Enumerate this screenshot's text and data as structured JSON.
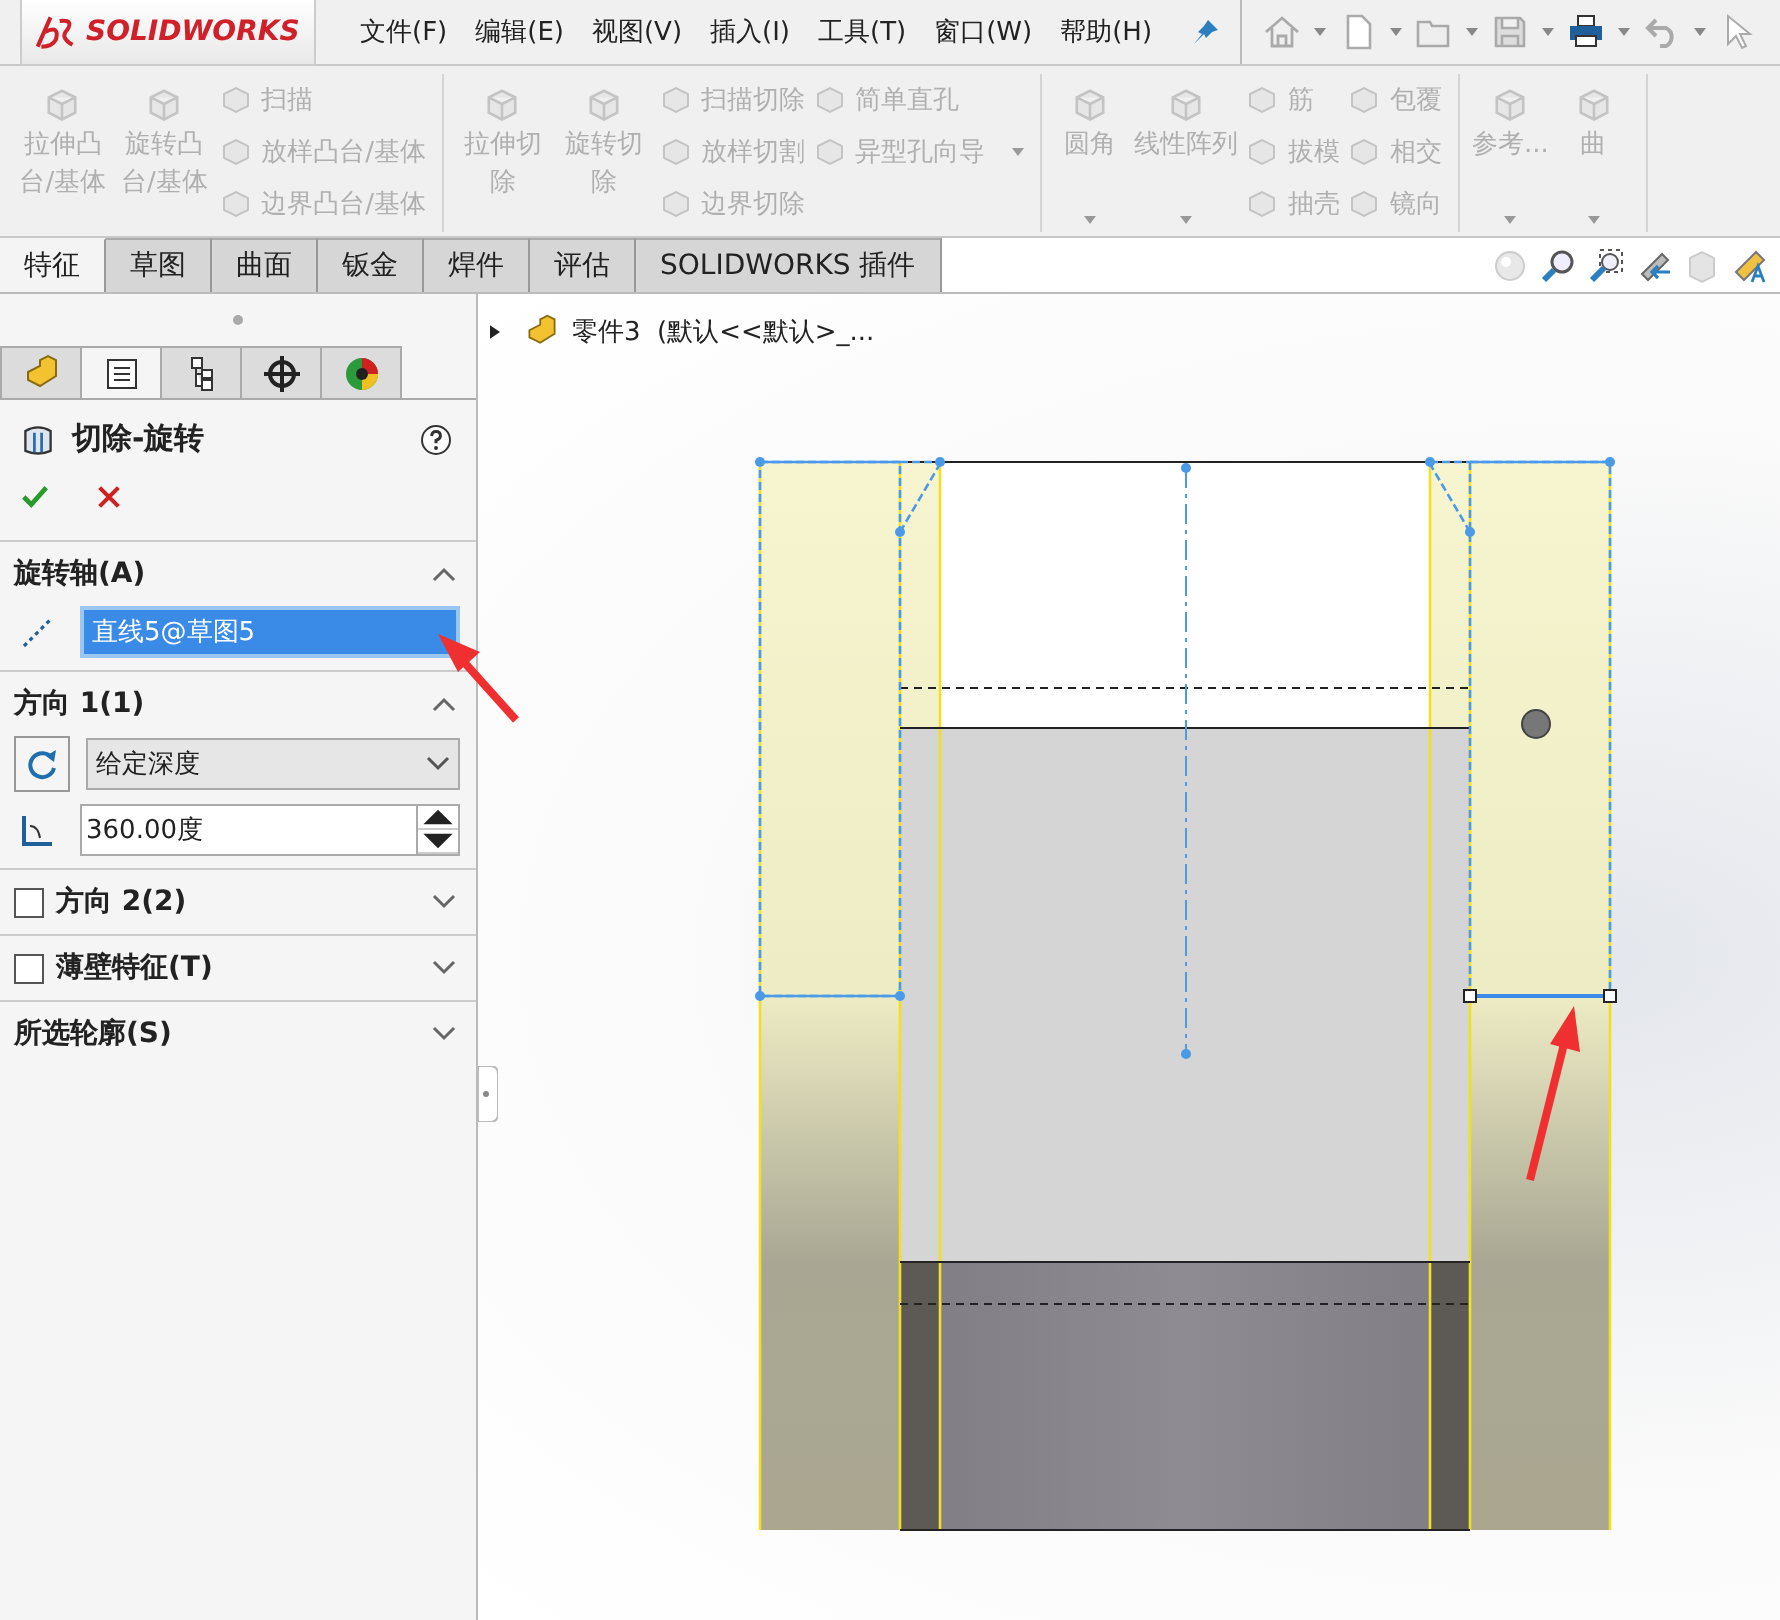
{
  "app": {
    "logo": "SOLIDWORKS"
  },
  "menu": [
    {
      "label": "文件(F)"
    },
    {
      "label": "编辑(E)"
    },
    {
      "label": "视图(V)"
    },
    {
      "label": "插入(I)"
    },
    {
      "label": "工具(T)"
    },
    {
      "label": "窗口(W)"
    },
    {
      "label": "帮助(H)"
    }
  ],
  "ribbon": [
    {
      "items": [
        {
          "kind": "large",
          "label": "拉伸凸台/基体"
        },
        {
          "kind": "large",
          "label": "旋转凸台/基体"
        },
        {
          "kind": "column",
          "dropdown": false,
          "entries": [
            "扫描",
            "放样凸台/基体",
            "边界凸台/基体"
          ]
        }
      ]
    },
    {
      "items": [
        {
          "kind": "large",
          "label": "拉伸切除"
        },
        {
          "kind": "large",
          "label": "旋转切除"
        },
        {
          "kind": "column",
          "dropdown": false,
          "entries": [
            "扫描切除",
            "放样切割",
            "边界切除"
          ]
        },
        {
          "kind": "column",
          "dropdown": true,
          "entries": [
            "简单直孔",
            "异型孔向导"
          ]
        }
      ]
    },
    {
      "items": [
        {
          "kind": "large-dropdown",
          "label": "圆角"
        },
        {
          "kind": "large-dropdown",
          "label": "线性阵列"
        },
        {
          "kind": "column",
          "dropdown": false,
          "entries": [
            "筋",
            "拔模",
            "抽壳"
          ]
        },
        {
          "kind": "column",
          "dropdown": false,
          "entries": [
            "包覆",
            "相交",
            "镜向"
          ]
        }
      ]
    },
    {
      "items": [
        {
          "kind": "large-dropdown",
          "label": "参考..."
        },
        {
          "kind": "large-dropdown",
          "label": "曲"
        }
      ]
    }
  ],
  "tabs": [
    {
      "label": "特征",
      "selected": true
    },
    {
      "label": "草图",
      "selected": false
    },
    {
      "label": "曲面",
      "selected": false
    },
    {
      "label": "钣金",
      "selected": false
    },
    {
      "label": "焊件",
      "selected": false
    },
    {
      "label": "评估",
      "selected": false
    },
    {
      "label": "SOLIDWORKS 插件",
      "selected": false
    }
  ],
  "panel_tabs": [
    {
      "selected": false
    },
    {
      "selected": true
    },
    {
      "selected": false
    },
    {
      "selected": false
    },
    {
      "selected": false
    }
  ],
  "feature": {
    "title": "切除-旋转"
  },
  "sections": [
    {
      "kind": "axis",
      "title": "旋转轴(A)",
      "expanded": true,
      "value": "直线5@草图5"
    },
    {
      "kind": "direction",
      "title": "方向 1(1)",
      "expanded": true,
      "end_condition": "给定深度",
      "angle": "360.00度"
    },
    {
      "kind": "checkbox",
      "title": "方向 2(2)",
      "expanded": false,
      "checked": false
    },
    {
      "kind": "checkbox",
      "title": "薄壁特征(T)",
      "expanded": false,
      "checked": false
    },
    {
      "kind": "plain",
      "title": "所选轮廓(S)",
      "expanded": false
    }
  ],
  "tree": {
    "label": "零件3  (默认<<默认>_..."
  }
}
